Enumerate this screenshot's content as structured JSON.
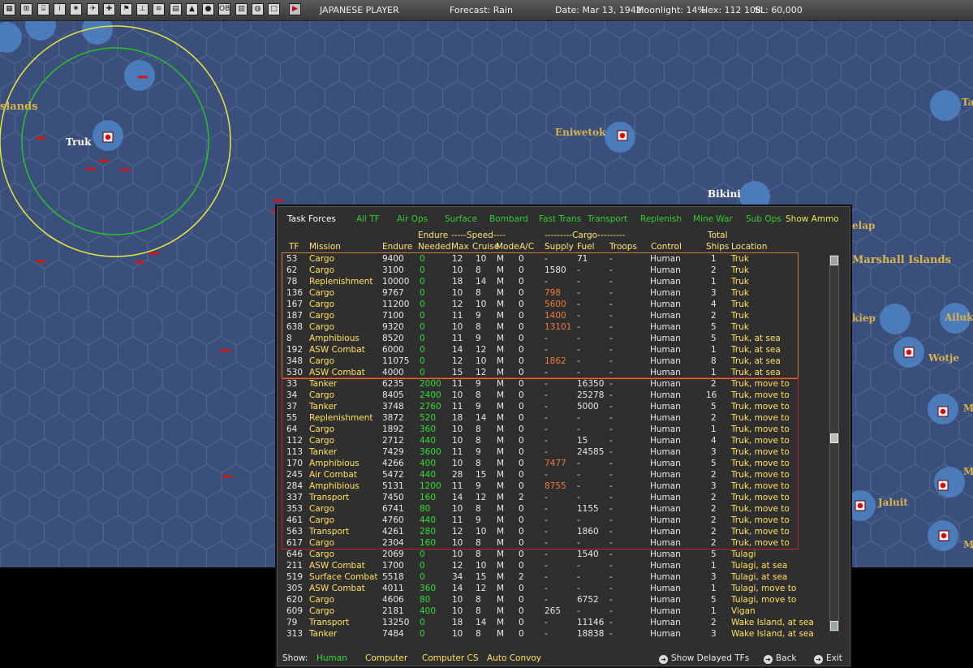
{
  "toolbar": {
    "icon_count": 19,
    "player": "JAPANESE PLAYER",
    "forecast": "Forecast: Rain",
    "date": "Date: Mar 13, 1942",
    "moonlight": "Moonlight: 14%",
    "hex": "Hex: 112 108",
    "sl": "SL: 60,000",
    "end_turn_icon": "play-icon"
  },
  "map": {
    "labels": {
      "islands": "slands",
      "truk": "Truk",
      "eniwetok": "Eniwetok",
      "bikini": "Bikini",
      "marshall": "Marshall Islands",
      "elap": "elap",
      "kiep": "kiep",
      "ailuk": "Ailuk",
      "wotje": "Wotje",
      "jaluit": "Jaluit",
      "ta": "Ta",
      "m1": "M",
      "m2": "M",
      "m3": "M"
    },
    "colors": {
      "ocean": "#3a4f7c",
      "hexline": "#55698f",
      "shallow": "#4f84c4",
      "yellow_ring": "#e7e83a",
      "green_ring": "#27c227"
    }
  },
  "panel": {
    "tabs": [
      "Task Forces",
      "All TF",
      "Air Ops",
      "Surface",
      "Bombard",
      "Fast Trans",
      "Transport",
      "Replenish",
      "Mine War",
      "Sub Ops",
      "Show Ammo"
    ],
    "headers": {
      "endure_top": "Endure",
      "speed_top": "-----Speed----",
      "cargo_top": "---------Cargo---------",
      "total_top": "Total",
      "tf": "TF",
      "mission": "Mission",
      "endure": "Endure",
      "needed": "Needed",
      "max": "Max",
      "cruise": "Cruise",
      "mode": "Mode",
      "ac": "A/C",
      "supply": "Supply",
      "fuel": "Fuel",
      "troops": "Troops",
      "control": "Control",
      "ships": "Ships",
      "location": "Location"
    },
    "rows": [
      [
        "53",
        "Cargo",
        "9400",
        "0",
        "12",
        "10",
        "M",
        "0",
        "-",
        "71",
        "-",
        "Human",
        "1",
        "Truk"
      ],
      [
        "62",
        "Cargo",
        "3100",
        "0",
        "10",
        "8",
        "M",
        "0",
        "1580",
        "-",
        "-",
        "Human",
        "2",
        "Truk"
      ],
      [
        "78",
        "Replenishment",
        "10000",
        "0",
        "18",
        "14",
        "M",
        "0",
        "-",
        "-",
        "-",
        "Human",
        "1",
        "Truk"
      ],
      [
        "136",
        "Cargo",
        "9767",
        "0",
        "10",
        "8",
        "M",
        "0",
        "798",
        "-",
        "-",
        "Human",
        "3",
        "Truk"
      ],
      [
        "167",
        "Cargo",
        "11200",
        "0",
        "12",
        "10",
        "M",
        "0",
        "5600",
        "-",
        "-",
        "Human",
        "4",
        "Truk"
      ],
      [
        "187",
        "Cargo",
        "7100",
        "0",
        "11",
        "9",
        "M",
        "0",
        "1400",
        "-",
        "-",
        "Human",
        "2",
        "Truk"
      ],
      [
        "638",
        "Cargo",
        "9320",
        "0",
        "10",
        "8",
        "M",
        "0",
        "13101",
        "-",
        "-",
        "Human",
        "5",
        "Truk"
      ],
      [
        "8",
        "Amphibious",
        "8520",
        "0",
        "11",
        "9",
        "M",
        "0",
        "-",
        "-",
        "-",
        "Human",
        "5",
        "Truk, at sea"
      ],
      [
        "192",
        "ASW Combat",
        "6000",
        "0",
        "14",
        "12",
        "M",
        "0",
        "-",
        "-",
        "-",
        "Human",
        "1",
        "Truk, at sea"
      ],
      [
        "348",
        "Cargo",
        "11075",
        "0",
        "12",
        "10",
        "M",
        "0",
        "1862",
        "-",
        "-",
        "Human",
        "8",
        "Truk, at sea"
      ],
      [
        "530",
        "ASW Combat",
        "4000",
        "0",
        "15",
        "12",
        "M",
        "0",
        "-",
        "-",
        "-",
        "Human",
        "1",
        "Truk, at sea"
      ],
      [
        "33",
        "Tanker",
        "6235",
        "2000",
        "11",
        "9",
        "M",
        "0",
        "-",
        "16350",
        "-",
        "Human",
        "2",
        "Truk, move to"
      ],
      [
        "34",
        "Cargo",
        "8405",
        "2400",
        "10",
        "8",
        "M",
        "0",
        "-",
        "25278",
        "-",
        "Human",
        "16",
        "Truk, move to"
      ],
      [
        "37",
        "Tanker",
        "3748",
        "2760",
        "11",
        "9",
        "M",
        "0",
        "-",
        "5000",
        "-",
        "Human",
        "5",
        "Truk, move to"
      ],
      [
        "55",
        "Replenishment",
        "3872",
        "520",
        "18",
        "14",
        "M",
        "0",
        "-",
        "-",
        "-",
        "Human",
        "2",
        "Truk, move to"
      ],
      [
        "64",
        "Cargo",
        "1892",
        "360",
        "10",
        "8",
        "M",
        "0",
        "-",
        "-",
        "-",
        "Human",
        "1",
        "Truk, move to"
      ],
      [
        "112",
        "Cargo",
        "2712",
        "440",
        "10",
        "8",
        "M",
        "0",
        "-",
        "15",
        "-",
        "Human",
        "4",
        "Truk, move to"
      ],
      [
        "113",
        "Tanker",
        "7429",
        "3600",
        "11",
        "9",
        "M",
        "0",
        "-",
        "24585",
        "-",
        "Human",
        "3",
        "Truk, move to"
      ],
      [
        "170",
        "Amphibious",
        "4266",
        "400",
        "10",
        "8",
        "M",
        "0",
        "7477",
        "-",
        "-",
        "Human",
        "5",
        "Truk, move to"
      ],
      [
        "245",
        "Air Combat",
        "5472",
        "440",
        "28",
        "15",
        "M",
        "0",
        "-",
        "-",
        "-",
        "Human",
        "2",
        "Truk, move to"
      ],
      [
        "284",
        "Amphibious",
        "5131",
        "1200",
        "11",
        "9",
        "M",
        "0",
        "8755",
        "-",
        "-",
        "Human",
        "3",
        "Truk, move to"
      ],
      [
        "337",
        "Transport",
        "7450",
        "160",
        "14",
        "12",
        "M",
        "2",
        "-",
        "-",
        "-",
        "Human",
        "2",
        "Truk, move to"
      ],
      [
        "353",
        "Cargo",
        "6741",
        "80",
        "10",
        "8",
        "M",
        "0",
        "-",
        "1155",
        "-",
        "Human",
        "2",
        "Truk, move to"
      ],
      [
        "461",
        "Cargo",
        "4760",
        "440",
        "11",
        "9",
        "M",
        "0",
        "-",
        "-",
        "-",
        "Human",
        "2",
        "Truk, move to"
      ],
      [
        "563",
        "Transport",
        "4261",
        "280",
        "12",
        "10",
        "M",
        "0",
        "-",
        "1860",
        "-",
        "Human",
        "2",
        "Truk, move to"
      ],
      [
        "617",
        "Cargo",
        "2304",
        "160",
        "10",
        "8",
        "M",
        "0",
        "-",
        "-",
        "-",
        "Human",
        "2",
        "Truk, move to"
      ],
      [
        "646",
        "Cargo",
        "2069",
        "0",
        "10",
        "8",
        "M",
        "0",
        "-",
        "1540",
        "-",
        "Human",
        "5",
        "Tulagi"
      ],
      [
        "211",
        "ASW Combat",
        "1700",
        "0",
        "12",
        "10",
        "M",
        "0",
        "-",
        "-",
        "-",
        "Human",
        "1",
        "Tulagi, at sea"
      ],
      [
        "519",
        "Surface Combat",
        "5518",
        "0",
        "34",
        "15",
        "M",
        "2",
        "-",
        "-",
        "-",
        "Human",
        "3",
        "Tulagi, at sea"
      ],
      [
        "305",
        "ASW Combat",
        "4011",
        "360",
        "14",
        "12",
        "M",
        "0",
        "-",
        "-",
        "-",
        "Human",
        "1",
        "Tulagi, move to"
      ],
      [
        "620",
        "Cargo",
        "4606",
        "80",
        "10",
        "8",
        "M",
        "0",
        "-",
        "6752",
        "-",
        "Human",
        "5",
        "Tulagi, move to"
      ],
      [
        "609",
        "Cargo",
        "2181",
        "400",
        "10",
        "8",
        "M",
        "0",
        "265",
        "-",
        "-",
        "Human",
        "1",
        "Vigan"
      ],
      [
        "79",
        "Transport",
        "13250",
        "0",
        "18",
        "14",
        "M",
        "0",
        "-",
        "11146",
        "-",
        "Human",
        "2",
        "Wake Island, at sea"
      ],
      [
        "313",
        "Tanker",
        "7484",
        "0",
        "10",
        "8",
        "M",
        "0",
        "-",
        "18838",
        "-",
        "Human",
        "3",
        "Wake Island, at sea"
      ]
    ],
    "orange_supply_rows": [
      3,
      4,
      5,
      6,
      9,
      18,
      20
    ],
    "group_colors": {
      "at_truk": "#d07a2a",
      "moving": "#c8202a"
    },
    "footer": {
      "show_label": "Show:",
      "human": "Human",
      "computer": "Computer",
      "computer_cs": "Computer CS",
      "auto_convoy": "Auto Convoy",
      "show_delayed": "Show Delayed TFs",
      "back": "Back",
      "exit": "Exit"
    }
  }
}
